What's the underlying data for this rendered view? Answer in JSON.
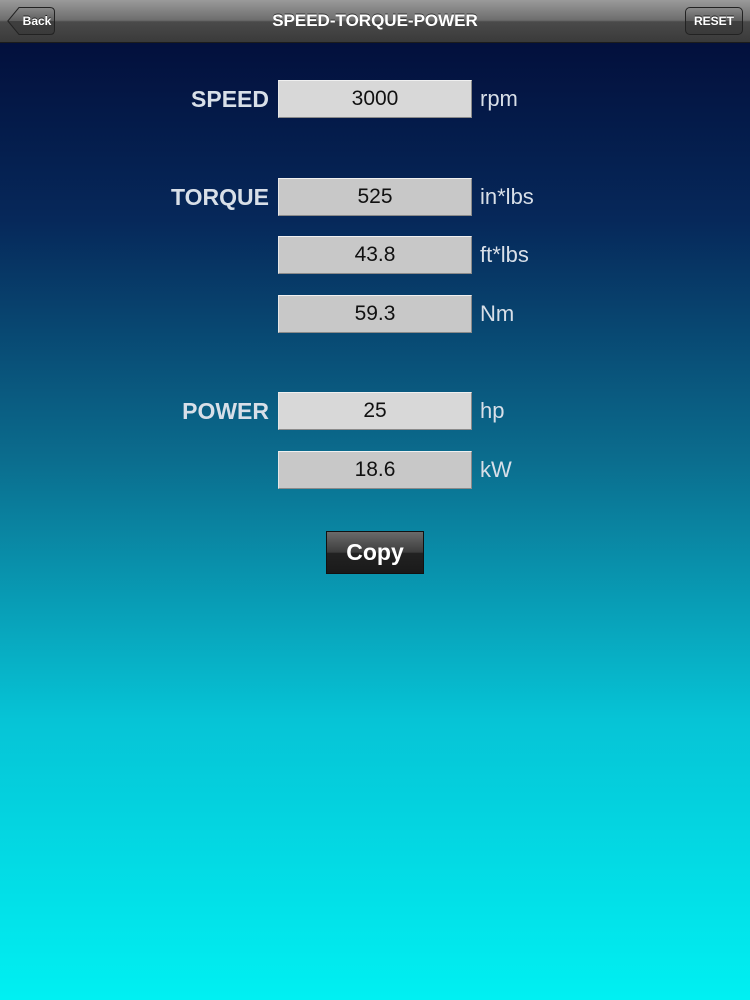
{
  "navbar": {
    "title": "SPEED-TORQUE-POWER",
    "back_label": "Back",
    "reset_label": "RESET"
  },
  "speed": {
    "label": "SPEED",
    "value": "3000",
    "unit": "rpm"
  },
  "torque": {
    "label": "TORQUE",
    "rows": [
      {
        "value": "525",
        "unit": "in*lbs"
      },
      {
        "value": "43.8",
        "unit": "ft*lbs"
      },
      {
        "value": "59.3",
        "unit": "Nm"
      }
    ]
  },
  "power": {
    "label": "POWER",
    "rows": [
      {
        "value": "25",
        "unit": "hp"
      },
      {
        "value": "18.6",
        "unit": "kW"
      }
    ]
  },
  "copy_label": "Copy",
  "colors": {
    "background_top": "#020a35",
    "background_bottom": "#00f0f2",
    "field": "#c8c8c8",
    "label_text": "#d8dfe8"
  }
}
